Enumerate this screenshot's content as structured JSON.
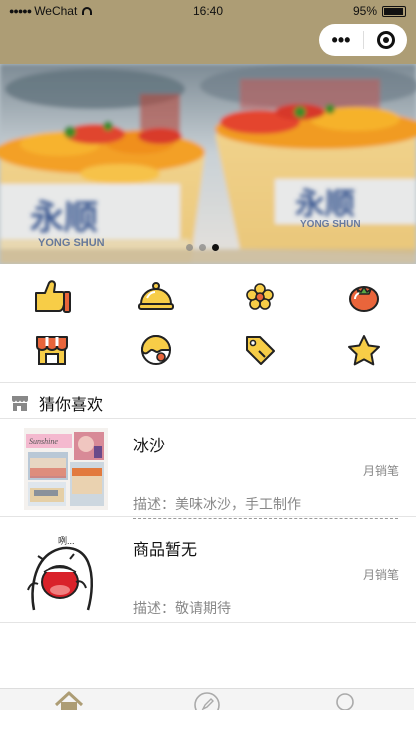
{
  "status_bar": {
    "carrier": "WeChat",
    "time": "16:40",
    "battery": "95%"
  },
  "capsule": {
    "more_icon": "more-dots-icon",
    "close_icon": "target-close-icon"
  },
  "banner": {
    "slide_count": 3,
    "active_index": 2,
    "sign_text": "永顺",
    "sign_subtext": "YONG SHUN"
  },
  "category_icons": [
    {
      "icon": "thumbs-up-icon"
    },
    {
      "icon": "food-cloche-icon"
    },
    {
      "icon": "flower-icon"
    },
    {
      "icon": "tomato-icon"
    },
    {
      "icon": "store-awning-icon"
    },
    {
      "icon": "pie-globe-icon"
    },
    {
      "icon": "price-tag-icon"
    },
    {
      "icon": "star-icon"
    }
  ],
  "section": {
    "title": "猜你喜欢",
    "icon": "shop-icon"
  },
  "products": [
    {
      "name": "冰沙",
      "sales_label": "月销笔",
      "description": "描述：美味冰沙，手工制作",
      "thumb_text": "Sunshine"
    },
    {
      "name": "商品暂无",
      "sales_label": "月销笔",
      "description": "描述：敬请期待",
      "thumb_text": "咧..."
    }
  ],
  "tabbar": {
    "tabs": [
      {
        "icon": "home-icon"
      },
      {
        "icon": "compass-icon"
      },
      {
        "icon": "profile-icon"
      }
    ]
  },
  "colors": {
    "navbar": "#ad9d75",
    "icon_yellow": "#f7cd47",
    "icon_outline": "#222222",
    "tomato": "#e9653b"
  }
}
